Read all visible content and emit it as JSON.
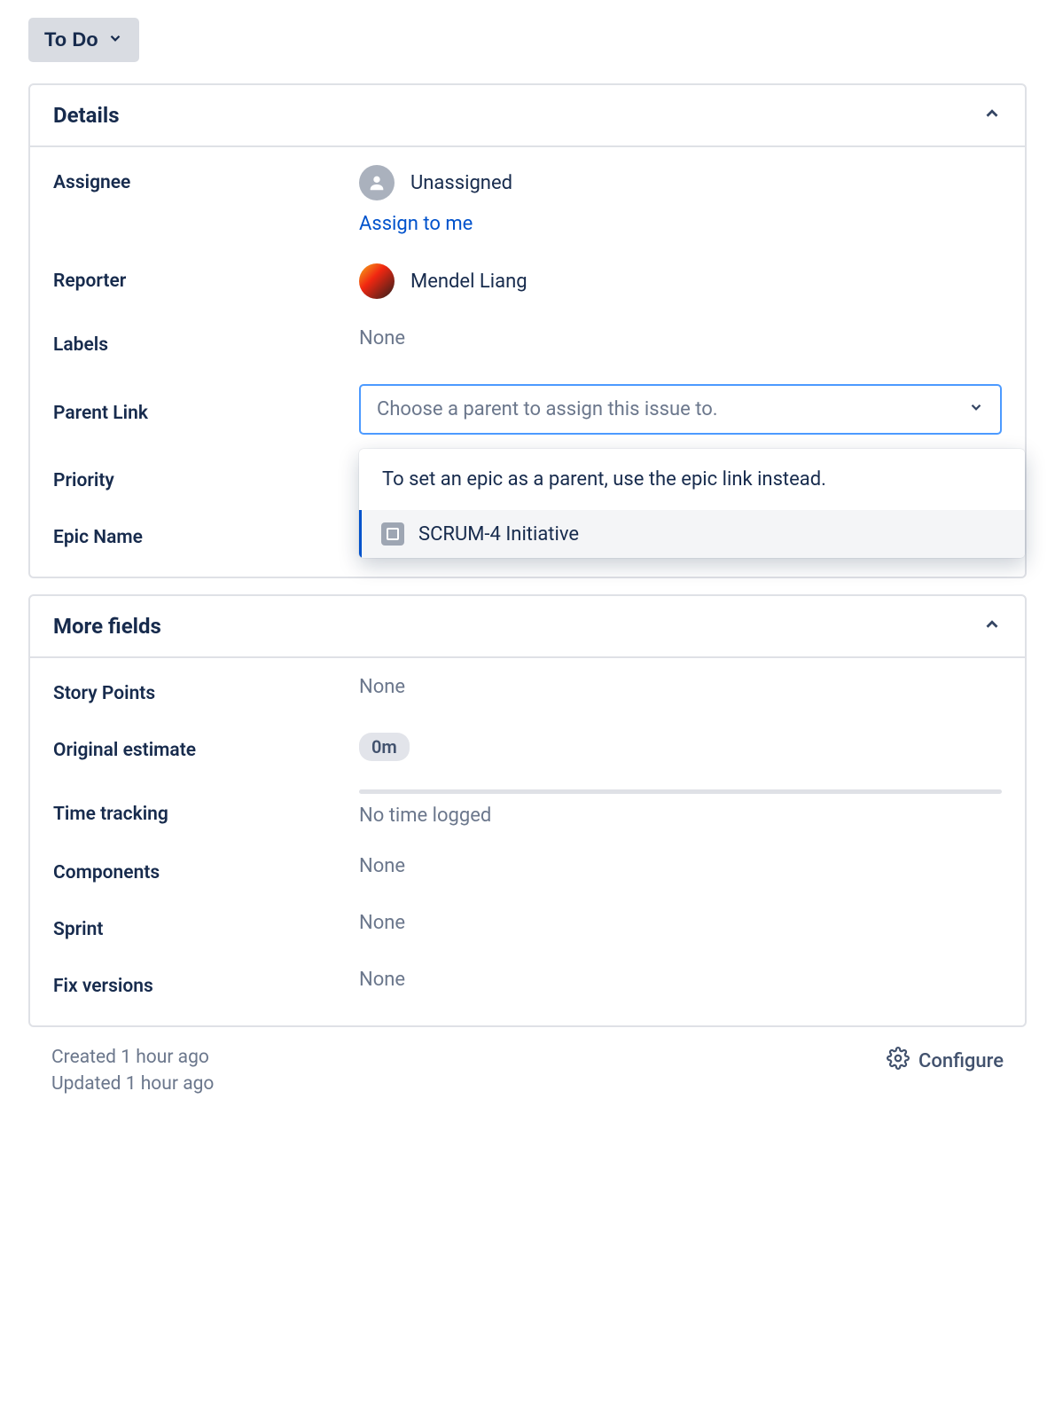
{
  "status": {
    "label": "To Do"
  },
  "panels": {
    "details": {
      "title": "Details",
      "assignee": {
        "label": "Assignee",
        "value": "Unassigned",
        "assign_to_me": "Assign to me"
      },
      "reporter": {
        "label": "Reporter",
        "value": "Mendel Liang"
      },
      "labels": {
        "label": "Labels",
        "value": "None"
      },
      "parent_link": {
        "label": "Parent Link",
        "placeholder": "Choose a parent to assign this issue to.",
        "dropdown": {
          "help": "To set an epic as a parent, use the epic link instead.",
          "option": "SCRUM-4 Initiative"
        }
      },
      "priority": {
        "label": "Priority"
      },
      "epic_name": {
        "label": "Epic Name"
      }
    },
    "more_fields": {
      "title": "More fields",
      "story_points": {
        "label": "Story Points",
        "value": "None"
      },
      "original_estimate": {
        "label": "Original estimate",
        "value": "0m"
      },
      "time_tracking": {
        "label": "Time tracking",
        "value": "No time logged"
      },
      "components": {
        "label": "Components",
        "value": "None"
      },
      "sprint": {
        "label": "Sprint",
        "value": "None"
      },
      "fix_versions": {
        "label": "Fix versions",
        "value": "None"
      }
    }
  },
  "footer": {
    "created": "Created 1 hour ago",
    "updated": "Updated 1 hour ago",
    "configure": "Configure"
  }
}
